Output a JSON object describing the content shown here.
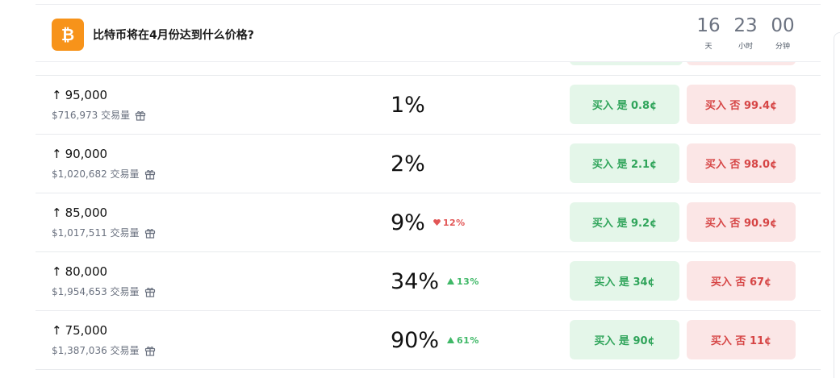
{
  "market": {
    "title": "比特币将在4月份达到什么价格?",
    "logo_icon": "bitcoin-icon",
    "logo_color": "#f7931a"
  },
  "countdown": [
    {
      "value": "16",
      "label": "天"
    },
    {
      "value": "23",
      "label": "小时"
    },
    {
      "value": "00",
      "label": "分钟"
    }
  ],
  "rows": [
    {
      "label": "95,000",
      "volume": "$716,973 交易量",
      "prob": "1%",
      "change": "",
      "direction": "",
      "yes": "买入 是 0.8¢",
      "no": "买入 否 99.4¢"
    },
    {
      "label": "90,000",
      "volume": "$1,020,682 交易量",
      "prob": "2%",
      "change": "",
      "direction": "",
      "yes": "买入 是 2.1¢",
      "no": "买入 否 98.0¢"
    },
    {
      "label": "85,000",
      "volume": "$1,017,511 交易量",
      "prob": "9%",
      "change": "12%",
      "direction": "down",
      "yes": "买入 是 9.2¢",
      "no": "买入 否 90.9¢"
    },
    {
      "label": "80,000",
      "volume": "$1,954,653 交易量",
      "prob": "34%",
      "change": "13%",
      "direction": "up",
      "yes": "买入 是 34¢",
      "no": "买入 否 67¢"
    },
    {
      "label": "75,000",
      "volume": "$1,387,036 交易量",
      "prob": "90%",
      "change": "61%",
      "direction": "up",
      "yes": "买入 是 90¢",
      "no": "买入 否 11¢"
    }
  ],
  "icons": {
    "arrow": "arrow-up-icon",
    "gift": "gift-icon",
    "up": "triangle-up-icon",
    "down": "heart-down-icon"
  },
  "colors": {
    "yes_bg": "#e4f6e9",
    "yes_text": "#2fa45a",
    "no_bg": "#fbe6e6",
    "no_text": "#d64545",
    "up": "#3fb867",
    "down": "#e25656"
  }
}
